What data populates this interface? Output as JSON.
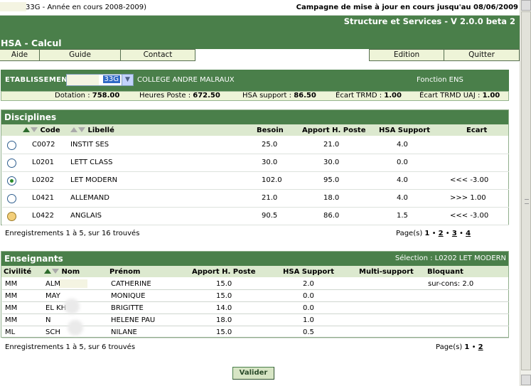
{
  "topbar": {
    "left": "33G - Année en cours 2008-2009)",
    "right": "Campagne de mise à jour en cours jusqu'au 08/06/2009"
  },
  "header": {
    "version": "Structure et Services - V 2.0.0 beta 2",
    "app_title": "HSA - Calcul"
  },
  "menu": {
    "aide": "Aide",
    "guide": "Guide",
    "contact": "Contact",
    "edition": "Edition",
    "quitter": "Quitter"
  },
  "etablissement": {
    "label": "ETABLISSEMENT",
    "selected": "33G",
    "college": "COLLEGE ANDRE MALRAUX",
    "fonction": "Fonction ENS"
  },
  "stats": {
    "dotation_label": "Dotation : ",
    "dotation_value": "758.00",
    "heures_label": "Heures Poste : ",
    "heures_value": "672.50",
    "hsa_label": "HSA support : ",
    "hsa_value": "86.50",
    "trmd_label": "Écart TRMD : ",
    "trmd_value": "1.00",
    "uaj_label": "Écart TRMD UAJ : ",
    "uaj_value": "1.00"
  },
  "disciplines": {
    "title": "Disciplines",
    "columns": {
      "code": "Code",
      "libelle": "Libellé",
      "besoin": "Besoin",
      "apport": "Apport H. Poste",
      "hsa": "HSA Support",
      "ecart": "Ecart"
    },
    "rows": [
      {
        "code": "C0072",
        "libelle": "INSTIT SES",
        "besoin": "25.0",
        "apport": "21.0",
        "hsa": "4.0",
        "ecart": ""
      },
      {
        "code": "L0201",
        "libelle": "LETT CLASS",
        "besoin": "30.0",
        "apport": "30.0",
        "hsa": "0.0",
        "ecart": ""
      },
      {
        "code": "L0202",
        "libelle": "LET MODERN",
        "besoin": "102.0",
        "apport": "95.0",
        "hsa": "4.0",
        "ecart": "<<< -3.00"
      },
      {
        "code": "L0421",
        "libelle": "ALLEMAND",
        "besoin": "21.0",
        "apport": "18.0",
        "hsa": "4.0",
        "ecart": ">>> 1.00"
      },
      {
        "code": "L0422",
        "libelle": "ANGLAIS",
        "besoin": "90.5",
        "apport": "86.0",
        "hsa": "1.5",
        "ecart": "<<< -3.00"
      }
    ],
    "footer": "Enregistrements 1 à 5, sur 16 trouvés",
    "pager_label": "Page(s)",
    "pages": [
      "1",
      "2",
      "3",
      "4"
    ]
  },
  "enseignants": {
    "title": "Enseignants",
    "selection": "Sélection : L0202 LET MODERN",
    "columns": {
      "civilite": "Civilité",
      "nom": "Nom",
      "prenom": "Prénom",
      "apport": "Apport H. Poste",
      "hsa": "HSA Support",
      "multi": "Multi-support",
      "bloquant": "Bloquant"
    },
    "rows": [
      {
        "civ": "MM",
        "nom": "ALM",
        "prenom": "CATHERINE",
        "apport": "15.0",
        "hsa": "2.0",
        "bloquant": "sur-cons: 2.0"
      },
      {
        "civ": "MM",
        "nom": "MAY",
        "prenom": "MONIQUE",
        "apport": "15.0",
        "hsa": "0.0",
        "bloquant": ""
      },
      {
        "civ": "MM",
        "nom": "EL KH",
        "prenom": "BRIGITTE",
        "apport": "14.0",
        "hsa": "0.0",
        "bloquant": ""
      },
      {
        "civ": "MM",
        "nom": "N",
        "prenom": "HELENE PAU",
        "apport": "18.0",
        "hsa": "1.0",
        "bloquant": ""
      },
      {
        "civ": "ML",
        "nom": "SCH",
        "prenom": "NILANE",
        "apport": "15.0",
        "hsa": "0.5",
        "bloquant": ""
      }
    ],
    "footer": "Enregistrements 1 à 5, sur 6 trouvés",
    "pager_label": "Page(s)",
    "pages": [
      "1",
      "2"
    ]
  },
  "actions": {
    "valider": "Valider"
  }
}
